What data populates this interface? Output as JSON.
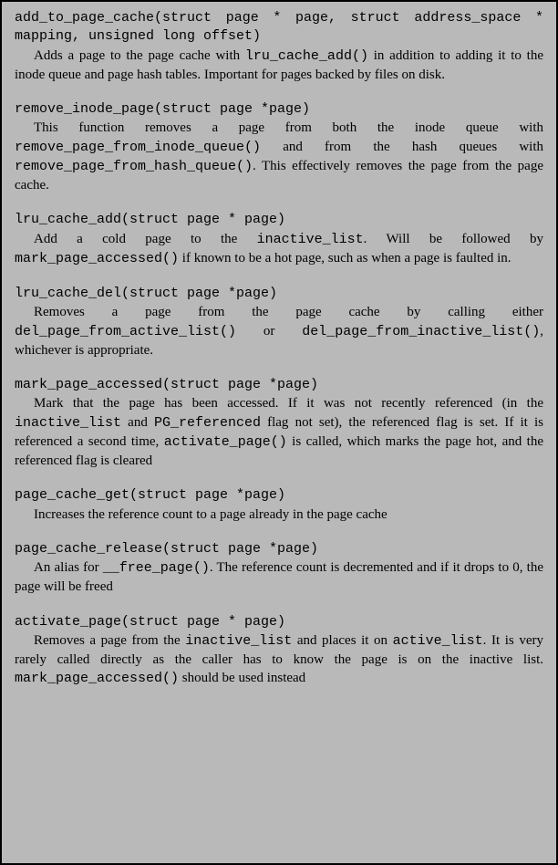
{
  "functions": [
    {
      "sig_line1": "add_to_page_cache(struct page * page, struct address_space *",
      "sig_line2": "mapping, unsigned long offset)",
      "d1a": "Adds a page to the page cache with ",
      "d1_c1": "lru_cache_add()",
      "d1b": " in addition to adding it to the inode queue and page hash tables. Important for pages backed by files on disk."
    },
    {
      "sig": "remove_inode_page(struct page *page)",
      "d1a": "This function removes a page from both the inode queue with ",
      "d1_c1": "remove_page_from_inode_queue()",
      "d1b": " and from the hash queues with ",
      "d1_c2": "remove_page_from_hash_queue()",
      "d1c": ". This effectively removes the page from the page cache."
    },
    {
      "sig": "lru_cache_add(struct page * page)",
      "d1a": "Add a cold page to the ",
      "d1_c1": "inactive_list",
      "d1b": ". Will be followed by ",
      "d1_c2": "mark_page_accessed()",
      "d1c": " if known to be a hot page, such as when a page is faulted in."
    },
    {
      "sig": "lru_cache_del(struct page *page)",
      "d1a": "Removes a page from the page cache by calling either ",
      "d1_c1": "del_page_from_active_list()",
      "d1b": " or ",
      "d1_c2": "del_page_from_inactive_list()",
      "d1c": ", whichever is appropriate."
    },
    {
      "sig": "mark_page_accessed(struct page *page)",
      "d1a": "Mark that the page has been accessed. If it was not recently referenced (in the ",
      "d1_c1": "inactive_list",
      "d1b": " and ",
      "d1_c2": "PG_referenced",
      "d1c": " flag not set), the referenced flag is set. If it is referenced a second time, ",
      "d1_c3": "activate_page()",
      "d1d": " is called, which marks the page hot, and the referenced flag is cleared"
    },
    {
      "sig": "page_cache_get(struct page *page)",
      "d1a": "Increases the reference count to a page already in the page cache"
    },
    {
      "sig": "page_cache_release(struct page *page)",
      "d1a": "An alias for ",
      "d1_c1": "__free_page()",
      "d1b": ". The reference count is decremented and if it drops to 0, the page will be freed"
    },
    {
      "sig": "activate_page(struct page * page)",
      "d1a": "Removes a page from the ",
      "d1_c1": "inactive_list",
      "d1b": " and places it on ",
      "d1_c2": "active_list",
      "d1c": ". It is very rarely called directly as the caller has to know the page is on the inactive list. ",
      "d1_c3": "mark_page_accessed()",
      "d1d": " should be used instead"
    }
  ]
}
